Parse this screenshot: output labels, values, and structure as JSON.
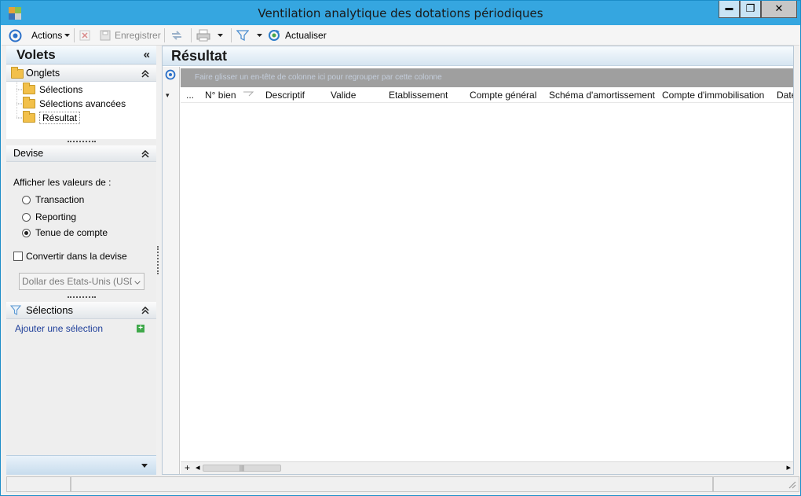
{
  "window": {
    "title": "Ventilation analytique des dotations périodiques",
    "minimize": "▬",
    "maximize": "❐",
    "close": "✕"
  },
  "toolbar": {
    "actions_label": "Actions",
    "save_label": "Enregistrer",
    "refresh_label": "Actualiser"
  },
  "left_panel": {
    "title": "Volets",
    "collapse_glyph": "«",
    "onglets": {
      "label": "Onglets",
      "items": [
        {
          "label": "Sélections"
        },
        {
          "label": "Sélections avancées"
        },
        {
          "label": "Résultat",
          "selected": true
        }
      ]
    },
    "devise": {
      "label": "Devise",
      "show_values_label": "Afficher les valeurs de :",
      "options": [
        {
          "label": "Transaction",
          "checked": false
        },
        {
          "label": "Reporting",
          "checked": false
        },
        {
          "label": "Tenue de compte",
          "checked": true
        }
      ],
      "convert_label": "Convertir dans la devise",
      "convert_checked": false,
      "currency_value": "Dollar des Etats-Unis (USD"
    },
    "selections": {
      "label": "Sélections",
      "add_link": "Ajouter une sélection",
      "add_glyph": "+"
    },
    "expand_glyph": "▾",
    "chevron_glyph": "⌃"
  },
  "result": {
    "title": "Résultat",
    "group_hint": "Faire glisser un en-tête de colonne ici pour regrouper par cette colonne",
    "columns": [
      "...",
      "N° bien",
      "Descriptif",
      "Valide",
      "Etablissement",
      "Compte général",
      "Schéma d'amortissement",
      "Compte d'immobilisation",
      "Date"
    ],
    "add_row_glyph": "+",
    "scroll_left": "◂",
    "scroll_right": "▸",
    "row_selector_glyph": "▾"
  },
  "colors": {
    "titlebar": "#35a6e0",
    "accent_blue": "#2a70c9",
    "group_bar": "#9f9f9f"
  }
}
